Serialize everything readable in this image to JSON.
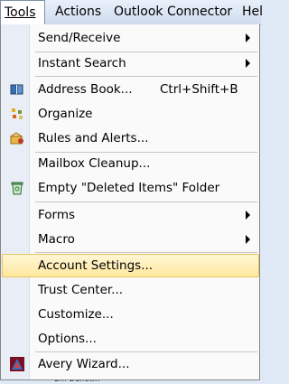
{
  "menubar": {
    "items": [
      {
        "label": "Tools"
      },
      {
        "label": "Actions"
      },
      {
        "label": "Outlook Connector"
      },
      {
        "label": "Hel"
      }
    ]
  },
  "menu": {
    "items": [
      {
        "label": "Send/Receive",
        "submenu": true
      },
      {
        "label": "Instant Search",
        "submenu": true
      },
      {
        "label": "Address Book...",
        "shortcut": "Ctrl+Shift+B",
        "icon": "address-book-icon"
      },
      {
        "label": "Organize",
        "icon": "organize-icon"
      },
      {
        "label": "Rules and Alerts...",
        "icon": "rules-alerts-icon"
      },
      {
        "label": "Mailbox Cleanup..."
      },
      {
        "label": "Empty \"Deleted Items\" Folder",
        "icon": "recycle-bin-icon"
      },
      {
        "label": "Forms",
        "submenu": true
      },
      {
        "label": "Macro",
        "submenu": true
      },
      {
        "label": "Account Settings...",
        "highlighted": true
      },
      {
        "label": "Trust Center..."
      },
      {
        "label": "Customize..."
      },
      {
        "label": "Options..."
      },
      {
        "label": "Avery Wizard...",
        "icon": "avery-icon"
      }
    ]
  },
  "background": {
    "partial_text": "Bill Bulletin"
  },
  "colors": {
    "highlight": "#ffe89e",
    "gutter": "#e9eef6",
    "menubar": "#cfdcef"
  }
}
